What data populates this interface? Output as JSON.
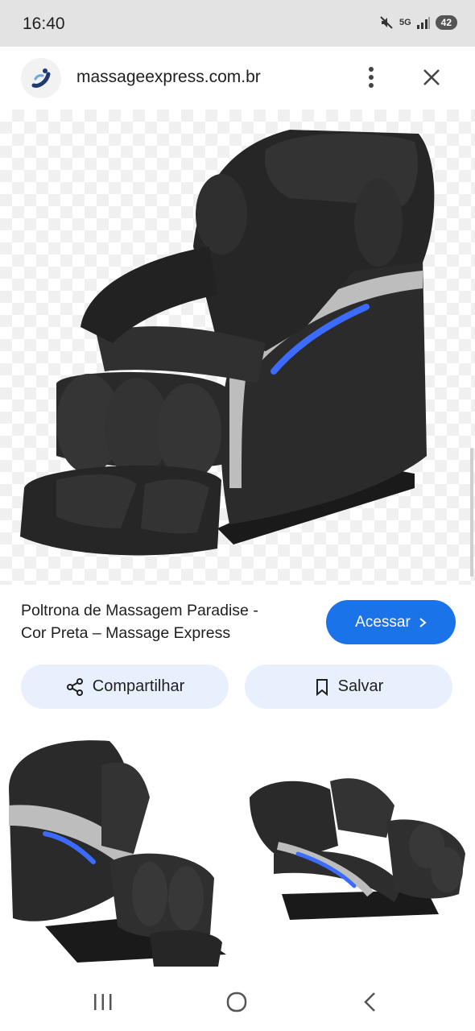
{
  "status_bar": {
    "time": "16:40",
    "network": "5G",
    "battery": "42"
  },
  "header": {
    "domain": "massageexpress.com.br",
    "logo_icon": "massage-express-logo",
    "more_icon": "more-vert-icon",
    "close_icon": "close-icon"
  },
  "result": {
    "title_line1": "Poltrona de Massagem Paradise -",
    "title_line2": "Cor Preta – Massage Express",
    "visit_label": "Acessar",
    "visit_icon": "chevron-right-icon"
  },
  "actions": {
    "share_label": "Compartilhar",
    "share_icon": "share-icon",
    "save_label": "Salvar",
    "save_icon": "bookmark-icon"
  },
  "colors": {
    "accent": "#1a73e8",
    "pill_bg": "#e8f0fe",
    "status_bg": "#e3e3e3",
    "chair": "#2b2b2b",
    "led": "#3b6cff"
  },
  "nav": {
    "recents_icon": "recents-icon",
    "home_icon": "home-icon",
    "back_icon": "back-icon"
  }
}
